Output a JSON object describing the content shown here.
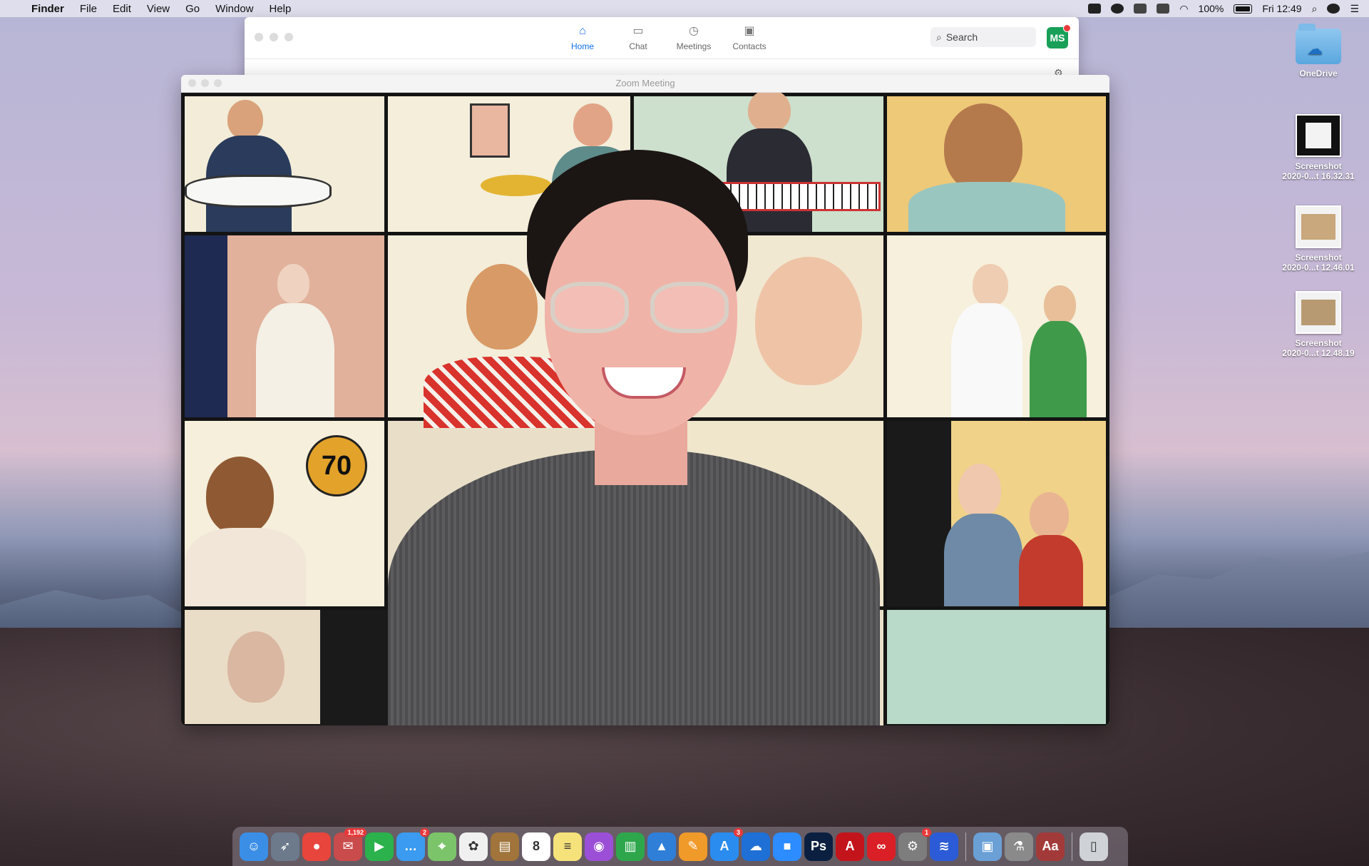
{
  "menubar": {
    "app_name": "Finder",
    "items": [
      "File",
      "Edit",
      "View",
      "Go",
      "Window",
      "Help"
    ],
    "battery": "100%",
    "clock": "Fri 12:49"
  },
  "zoom_main": {
    "tabs": [
      {
        "label": "Home",
        "icon": "home-icon",
        "active": true
      },
      {
        "label": "Chat",
        "icon": "chat-icon",
        "active": false
      },
      {
        "label": "Meetings",
        "icon": "clock-icon",
        "active": false
      },
      {
        "label": "Contacts",
        "icon": "contacts-icon",
        "active": false
      }
    ],
    "search_placeholder": "Search",
    "avatar_initials": "MS",
    "accent": "#0e71eb"
  },
  "meeting": {
    "title": "Zoom Meeting",
    "balloon_text": "70"
  },
  "desktop_icons": [
    {
      "label": "OneDrive"
    },
    {
      "label_line1": "Screenshot",
      "label_line2": "2020-0...t 16.32.31"
    },
    {
      "label_line1": "Screenshot",
      "label_line2": "2020-0...t 12.46.01"
    },
    {
      "label_line1": "Screenshot",
      "label_line2": "2020-0...t 12.48.19"
    }
  ],
  "dock": {
    "apps": [
      {
        "name": "finder-app",
        "color": "#3a8ee6",
        "glyph": "☺"
      },
      {
        "name": "launchpad-app",
        "color": "#6c7a8c",
        "glyph": "➶"
      },
      {
        "name": "chrome-app",
        "color": "#e8453c",
        "glyph": "●"
      },
      {
        "name": "stamps-app",
        "color": "#c94b4b",
        "glyph": "✉",
        "badge": "1,192"
      },
      {
        "name": "facetime-app",
        "color": "#2bb24c",
        "glyph": "▶"
      },
      {
        "name": "messages-app",
        "color": "#3a9bf0",
        "glyph": "…",
        "badge": "2"
      },
      {
        "name": "maps-app",
        "color": "#7cc46a",
        "glyph": "⌖"
      },
      {
        "name": "photos-app",
        "color": "#f0f0f0",
        "glyph": "✿"
      },
      {
        "name": "notebook-app",
        "color": "#a0743a",
        "glyph": "▤"
      },
      {
        "name": "calendar-app",
        "color": "#ffffff",
        "glyph": "8"
      },
      {
        "name": "notes-app",
        "color": "#f6e27a",
        "glyph": "≡"
      },
      {
        "name": "podcasts-app",
        "color": "#9b4fd6",
        "glyph": "◉"
      },
      {
        "name": "numbers-app",
        "color": "#2ea74c",
        "glyph": "▥"
      },
      {
        "name": "keynote-app",
        "color": "#2f7fd8",
        "glyph": "▲"
      },
      {
        "name": "pages-app",
        "color": "#f09a2a",
        "glyph": "✎"
      },
      {
        "name": "appstore-app",
        "color": "#2b8cf0",
        "glyph": "A",
        "badge": "3"
      },
      {
        "name": "onedrive-app",
        "color": "#1e6fd6",
        "glyph": "☁"
      },
      {
        "name": "zoom-app",
        "color": "#2d8cff",
        "glyph": "■"
      },
      {
        "name": "photoshop-app",
        "color": "#0b2040",
        "glyph": "Ps"
      },
      {
        "name": "acrobat-app",
        "color": "#c4141b",
        "glyph": "A"
      },
      {
        "name": "creativecloud-app",
        "color": "#da1f26",
        "glyph": "∞"
      },
      {
        "name": "systemprefs-app",
        "color": "#7d7d7d",
        "glyph": "⚙",
        "badge": "1"
      },
      {
        "name": "scanner-app",
        "color": "#2b5bd6",
        "glyph": "≋"
      },
      {
        "name": "preview-app",
        "color": "#6aa0d6",
        "glyph": "▣"
      },
      {
        "name": "script-app",
        "color": "#8a8a8a",
        "glyph": "⚗"
      },
      {
        "name": "dictionary-app",
        "color": "#a23a3a",
        "glyph": "Aa"
      },
      {
        "name": "trash-app",
        "color": "#cfd2d6",
        "glyph": "▯"
      }
    ]
  }
}
